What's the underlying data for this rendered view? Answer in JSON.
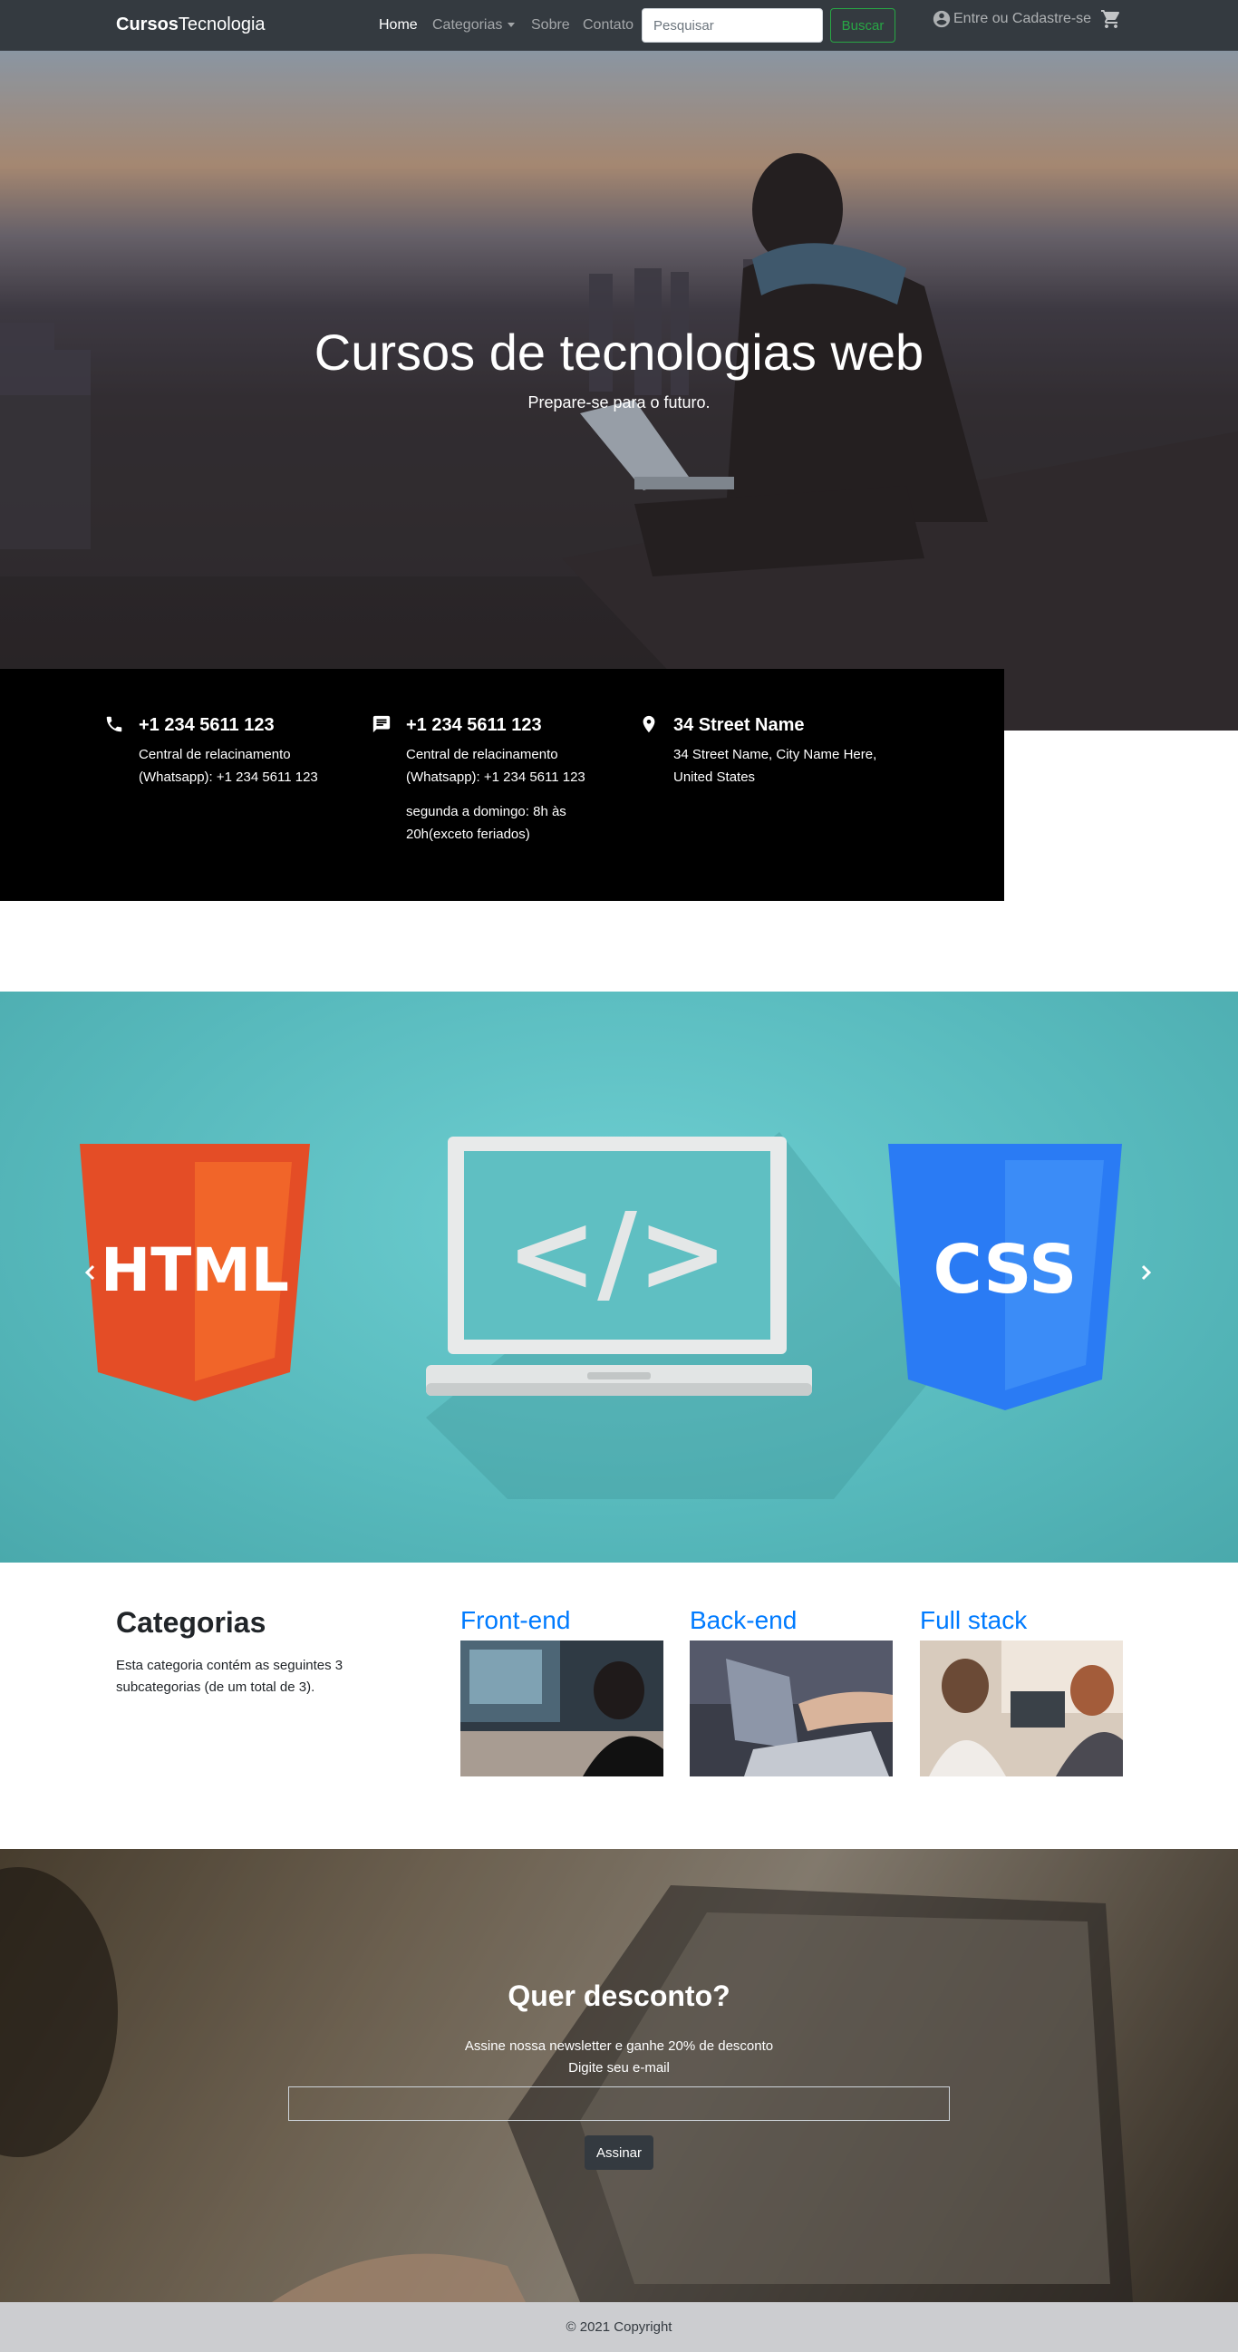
{
  "navbar": {
    "brand_bold": "Cursos",
    "brand_rest": "Tecnologia",
    "links": [
      "Home",
      "Categorias",
      "Sobre",
      "Contato"
    ],
    "search_placeholder": "Pesquisar",
    "search_button": "Buscar",
    "login_label": "Entre ou Cadastre-se",
    "icons": [
      "account-circle-icon",
      "cart-icon",
      "chevron-down-icon"
    ]
  },
  "hero": {
    "title": "Cursos de tecnologias web",
    "subtitle": "Prepare-se para o futuro."
  },
  "contact": [
    {
      "icon": "phone-icon",
      "heading": "+1 234 5611 123",
      "text": "Central de relacinamento (Whatsapp): +1 234 5611 123",
      "extra": ""
    },
    {
      "icon": "chat-icon",
      "heading": "+1 234 5611 123",
      "text": "Central de relacinamento (Whatsapp): +1 234 5611 123",
      "extra": "segunda a domingo: 8h às 20h(exceto feriados)"
    },
    {
      "icon": "location-pin-icon",
      "heading": "34 Street Name",
      "text": "34 Street Name, City Name Here, United States",
      "extra": ""
    }
  ],
  "carousel": {
    "slide_badges": [
      "HTML",
      "</>",
      "CSS"
    ],
    "colors": {
      "html": "#e44d26",
      "css": "#2a7bf4",
      "background": "#5cc0c3"
    }
  },
  "categories": {
    "title": "Categorias",
    "description": "Esta categoria contém as seguintes 3 subcategorias (de um total de 3).",
    "items": [
      {
        "name": "Front-end"
      },
      {
        "name": "Back-end"
      },
      {
        "name": "Full stack"
      }
    ]
  },
  "newsletter": {
    "title": "Quer desconto?",
    "line1": "Assine nossa newsletter e ganhe 20% de desconto",
    "line2": "Digite seu e-mail",
    "button": "Assinar"
  },
  "footer": {
    "copyright": "© 2021 Copyright"
  }
}
